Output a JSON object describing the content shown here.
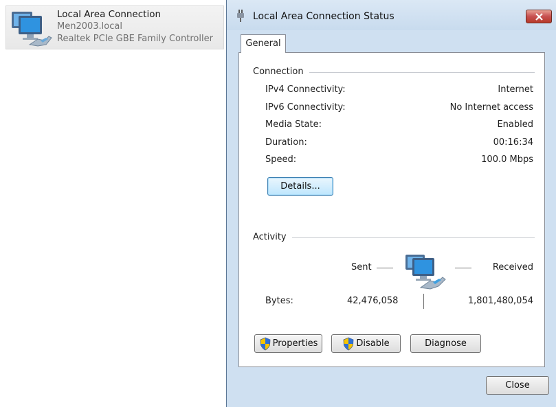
{
  "adapter": {
    "name": "Local Area Connection",
    "domain": "Men2003.local",
    "device": "Realtek PCIe GBE Family Controller",
    "icon": "network-adapter-icon"
  },
  "dialog": {
    "title": "Local Area Connection Status",
    "tab": "General",
    "connection": {
      "group_title": "Connection",
      "rows": [
        {
          "label": "IPv4 Connectivity:",
          "value": "Internet"
        },
        {
          "label": "IPv6 Connectivity:",
          "value": "No Internet access"
        },
        {
          "label": "Media State:",
          "value": "Enabled"
        },
        {
          "label": "Duration:",
          "value": "00:16:34"
        },
        {
          "label": "Speed:",
          "value": "100.0 Mbps"
        }
      ],
      "details_button": "Details..."
    },
    "activity": {
      "group_title": "Activity",
      "sent_label": "Sent",
      "received_label": "Received",
      "bytes_label": "Bytes:",
      "bytes_sent": "42,476,058",
      "bytes_received": "1,801,480,054"
    },
    "buttons": {
      "properties": "Properties",
      "disable": "Disable",
      "diagnose": "Diagnose",
      "close": "Close"
    },
    "colors": {
      "frame": "#cfe0f1",
      "close_button": "#c75050",
      "default_button": "#bee6fd"
    }
  }
}
